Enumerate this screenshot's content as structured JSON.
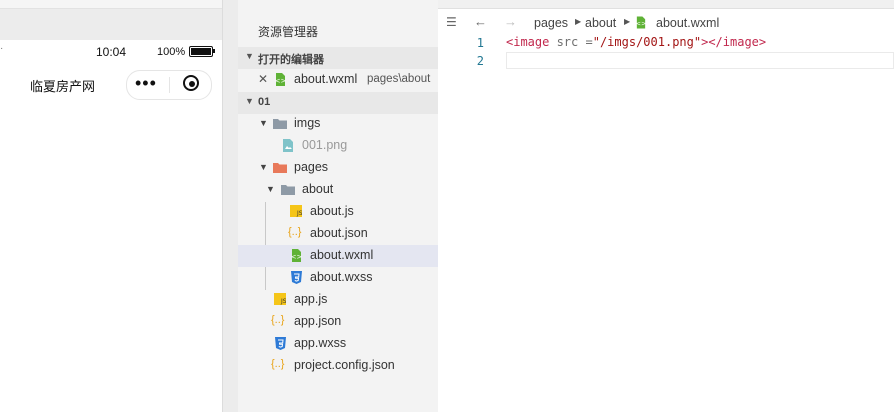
{
  "simulator": {
    "status_bar": {
      "time": "10:04",
      "battery": "100%",
      "battery_level": 1.0
    },
    "nav_title": "临夏房产网",
    "capsule": {
      "more": "•••"
    }
  },
  "explorer": {
    "title": "资源管理器",
    "open_editors": {
      "header": "打开的编辑器",
      "items": [
        {
          "name": "about.wxml",
          "path": "pages\\about"
        }
      ]
    },
    "project": {
      "header": "01",
      "tree": [
        {
          "name": "imgs",
          "type": "folder"
        },
        {
          "name": "001.png",
          "type": "image"
        },
        {
          "name": "pages",
          "type": "folder"
        },
        {
          "name": "about",
          "type": "folder"
        },
        {
          "name": "about.js",
          "type": "js"
        },
        {
          "name": "about.json",
          "type": "json"
        },
        {
          "name": "about.wxml",
          "type": "wxml",
          "selected": true
        },
        {
          "name": "about.wxss",
          "type": "wxss"
        },
        {
          "name": "app.js",
          "type": "js"
        },
        {
          "name": "app.json",
          "type": "json"
        },
        {
          "name": "app.wxss",
          "type": "wxss"
        },
        {
          "name": "project.config.json",
          "type": "json"
        }
      ]
    }
  },
  "editor": {
    "breadcrumb": [
      "pages",
      "about",
      "about.wxml"
    ],
    "lines": [
      {
        "num": "1",
        "open_tag": "<image",
        "attr": " src =",
        "value": "\"/imgs/001.png\"",
        "close": ">",
        "end_tag": "</image>"
      },
      {
        "num": "2"
      }
    ]
  },
  "colors": {
    "js_icon": "#f5c518",
    "json_icon": "#e8a317",
    "wxml_icon": "#5fb236",
    "wxss_icon": "#2d7ad6",
    "folder_icon": "#8e9aa6",
    "pages_folder_icon": "#e8795a",
    "selected_row": "#e4e6f1"
  }
}
